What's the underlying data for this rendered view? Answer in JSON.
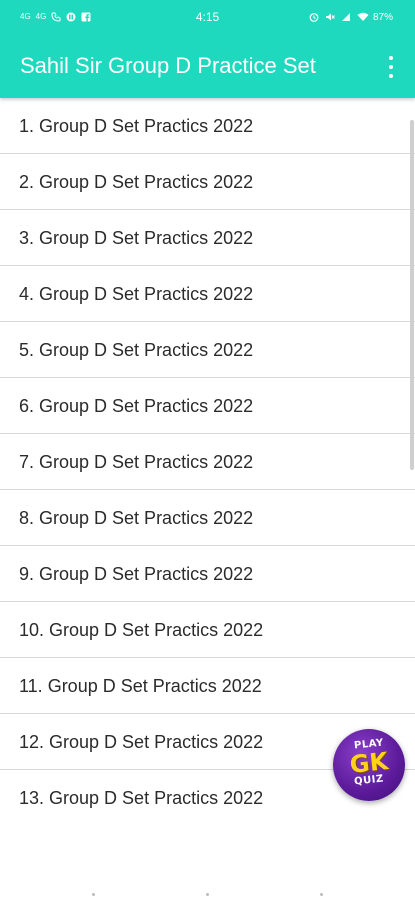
{
  "status_bar": {
    "signal_1": "4G",
    "signal_2": "4G",
    "time": "4:15",
    "battery": "87%"
  },
  "app_bar": {
    "title": "Sahil Sir Group D Practice Set",
    "menu_icon": "more-vert-icon"
  },
  "sets": [
    {
      "label": "1. Group D Set Practics 2022"
    },
    {
      "label": "2. Group D Set Practics 2022"
    },
    {
      "label": "3. Group D Set Practics 2022"
    },
    {
      "label": "4. Group D Set Practics 2022"
    },
    {
      "label": "5. Group D Set Practics 2022"
    },
    {
      "label": "6. Group D Set Practics 2022"
    },
    {
      "label": "7. Group D Set Practics 2022"
    },
    {
      "label": "8. Group D Set Practics 2022"
    },
    {
      "label": "9. Group D Set Practics 2022"
    },
    {
      "label": "10. Group D Set Practics 2022"
    },
    {
      "label": "11. Group D Set Practics 2022"
    },
    {
      "label": "12. Group D Set Practics 2022"
    },
    {
      "label": "13. Group D Set Practics 2022"
    }
  ],
  "quiz_badge": {
    "play": "PLAY",
    "gk": "GK",
    "quiz": "QUIZ"
  },
  "colors": {
    "accent": "#1ed9bd",
    "badge": "#5b1a9a"
  }
}
